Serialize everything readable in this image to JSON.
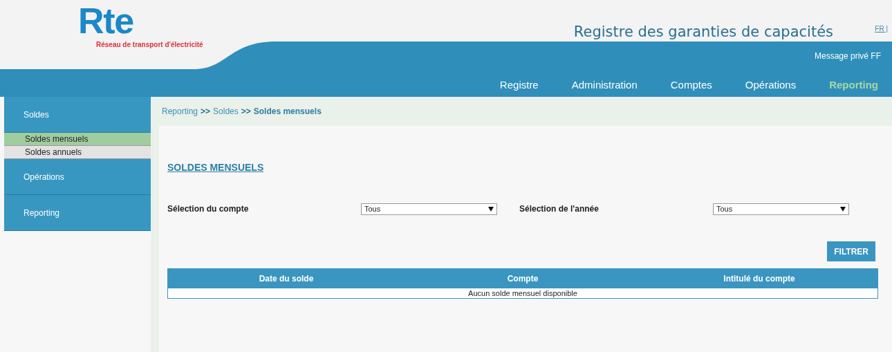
{
  "header": {
    "logo": "Rte",
    "tagline": "Réseau de transport d'électricité",
    "title": "Registre des garanties de capacités",
    "language": {
      "label": "FR |",
      "selected": true
    },
    "message": "Message privé FF"
  },
  "nav": [
    {
      "label": "Registre",
      "selected": false
    },
    {
      "label": "Administration",
      "selected": false
    },
    {
      "label": "Comptes",
      "selected": false
    },
    {
      "label": "Opérations",
      "selected": false
    },
    {
      "label": "Reporting",
      "selected": true
    }
  ],
  "sidebar": {
    "sections": [
      {
        "label": "Soldes",
        "children": [
          {
            "label": "Soldes mensuels",
            "selected": true
          },
          {
            "label": "Soldes annuels",
            "selected": false
          }
        ]
      },
      {
        "label": "Opérations"
      },
      {
        "label": "Reporting"
      }
    ]
  },
  "breadcrumb": {
    "links": [
      "Reporting",
      "Soldes"
    ],
    "separator": ">>",
    "current": "Soldes mensuels"
  },
  "page_title": "SOLDES MENSUELS",
  "filters": [
    {
      "label": "Sélection du compte",
      "value": "Tous"
    },
    {
      "label": "Sélection de l'année",
      "value": "Tous"
    }
  ],
  "filter_button": "FILTRER",
  "table": {
    "columns": [
      "Date du solde",
      "Compte",
      "Intitulé du compte"
    ],
    "empty_message": "Aucun solde mensuel disponible"
  }
}
